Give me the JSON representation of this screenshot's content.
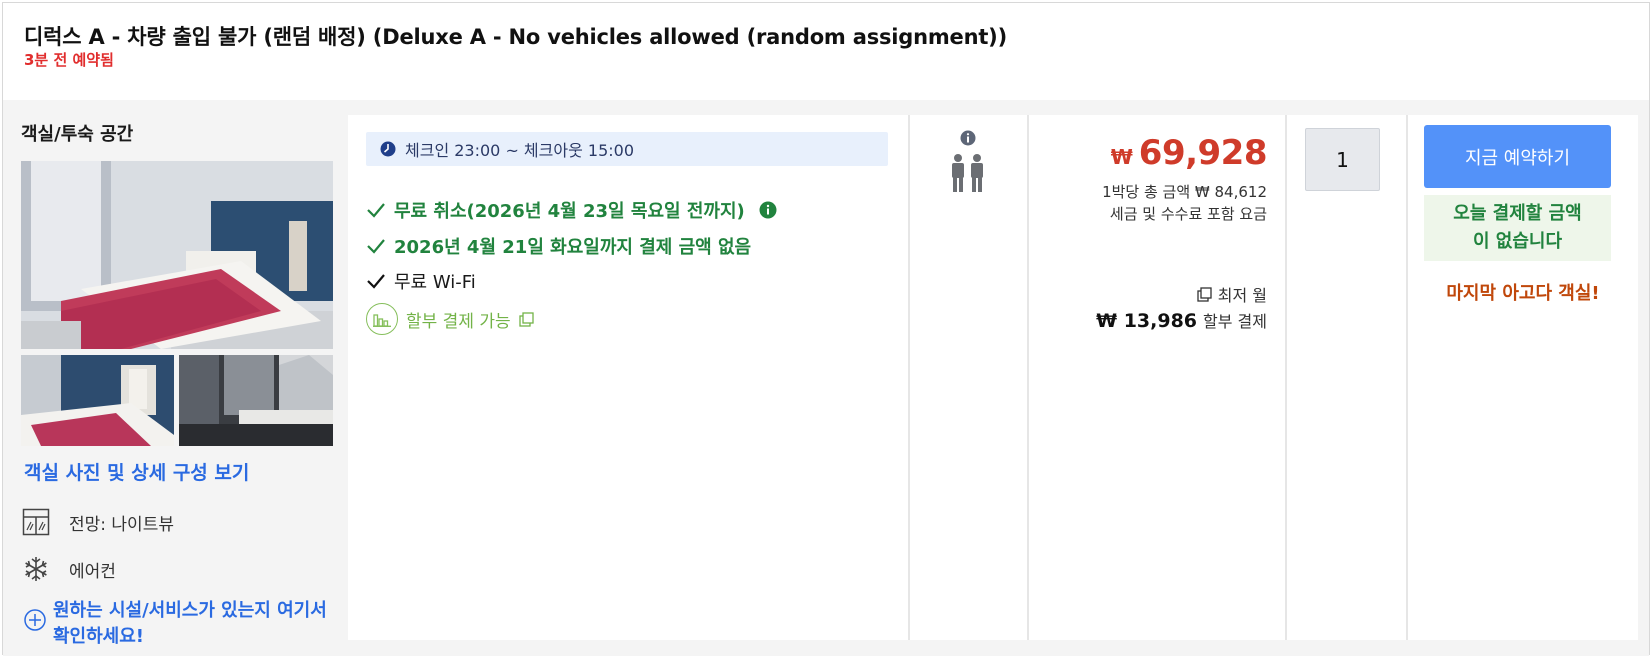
{
  "header": {
    "room_title": "디럭스 A - 차량 출입 불가 (랜덤 배정) (Deluxe A - No vehicles allowed (random assignment))",
    "booked_note": "3분 전 예약됨"
  },
  "left": {
    "space_title": "객실/투숙 공간",
    "view_photos_link": "객실 사진 및 상세 구성 보기",
    "facilities": [
      {
        "icon": "window-view-icon",
        "label": "전망: 나이트뷰"
      },
      {
        "icon": "snowflake-icon",
        "label": "에어컨"
      }
    ],
    "find_link": "원하는 시설/서비스가 있는지 여기서 확인하세요!"
  },
  "benefits": {
    "checkin": "체크인 23:00 ~ 체크아웃 15:00",
    "items": [
      {
        "text": "무료 취소(2026년 4월 23일 목요일 전까지)",
        "style": "green",
        "has_info": true
      },
      {
        "text": "2026년 4월 21일 화요일까지 결제 금액 없음",
        "style": "green"
      },
      {
        "text": "무료 Wi-Fi",
        "style": "plain"
      }
    ],
    "installment": "할부 결제 가능"
  },
  "occupancy": {
    "icon": "two-adults-icon",
    "info_icon": "info-icon"
  },
  "price": {
    "currency_symbol": "₩",
    "amount": "69,928",
    "per_night_total": "1박당 총 금액 ₩ 84,612",
    "tax_note": "세금 및 수수료 포함 요금",
    "monthly_label": "최저 월",
    "monthly_amount": "₩ 13,986",
    "monthly_suffix": "할부 결제"
  },
  "quantity": {
    "selected": "1"
  },
  "booking": {
    "button_label": "지금 예약하기",
    "no_pay_line1": "오늘 결제할 금액",
    "no_pay_line2": "이 없습니다",
    "last_room": "마지막 아고다 객실!"
  },
  "colors": {
    "link_blue": "#2a6ae1",
    "price_red": "#cf3b2a",
    "benefit_green": "#21833e",
    "button_blue": "#5392f9",
    "urgency_orange": "#c0470a",
    "alert_red": "#e12d2d"
  }
}
